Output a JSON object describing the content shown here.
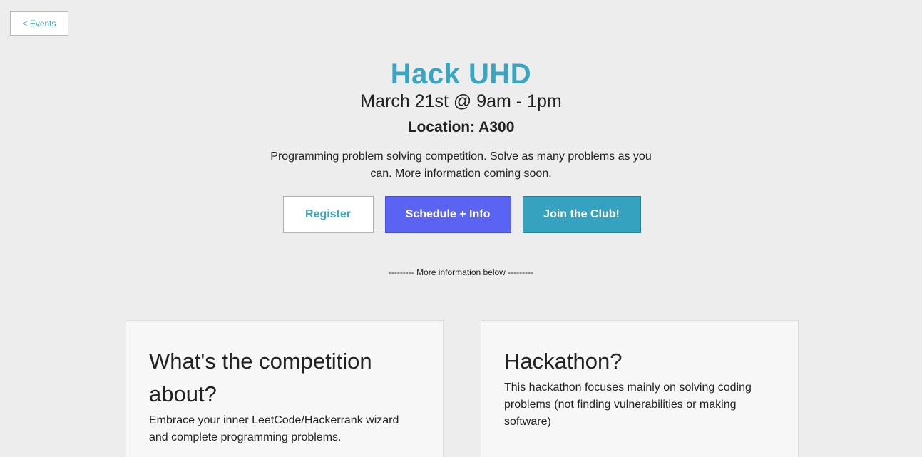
{
  "nav": {
    "back_label": "< Events"
  },
  "event": {
    "title": "Hack UHD",
    "date": "March 21st @ 9am - 1pm",
    "location": "Location: A300",
    "description": "Programming problem solving competition. Solve as many problems as you can. More information coming soon."
  },
  "actions": {
    "register_label": "Register",
    "schedule_label": "Schedule + Info",
    "join_label": "Join the Club!"
  },
  "divider_text": "--------- More information below ---------",
  "cards": [
    {
      "title": "What's the competition about?",
      "text": "Embrace your inner LeetCode/Hackerrank wizard and complete programming problems."
    },
    {
      "title": "Hackathon?",
      "text": "This hackathon focuses mainly on solving coding problems (not finding vulnerabilities or making software)"
    }
  ],
  "colors": {
    "background": "#ededed",
    "accent": "#3aa5c1",
    "schedule_button": "#5b63f2",
    "join_button": "#35a2c0",
    "card_background": "#f7f7f7"
  }
}
